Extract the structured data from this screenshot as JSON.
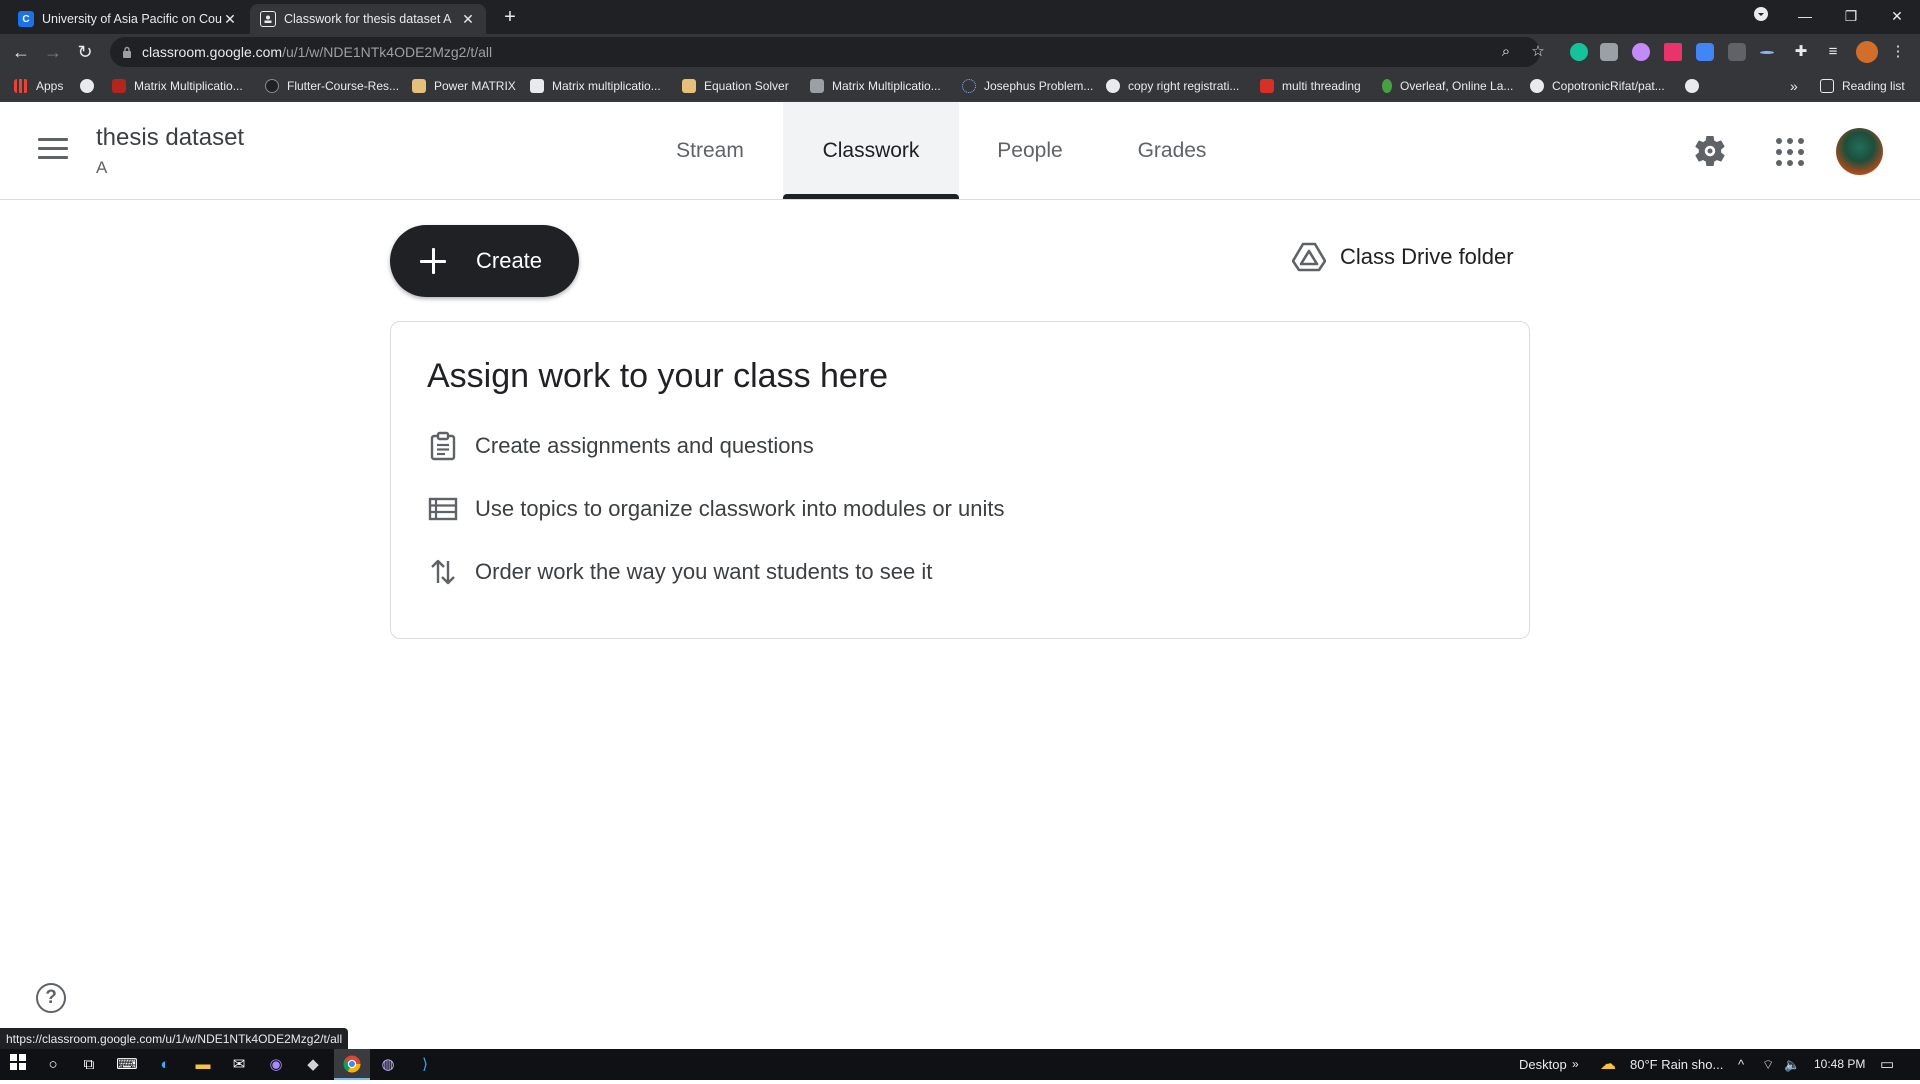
{
  "browser": {
    "tabs": [
      {
        "title": "University of Asia Pacific on Cour",
        "favicon": "C"
      },
      {
        "title": "Classwork for thesis dataset A"
      }
    ],
    "new_tab_label": "+",
    "url_host": "classroom.google.com",
    "url_path": "/u/1/w/NDE1NTk4ODE2Mzg2/t/all",
    "bookmarks": [
      "Apps",
      "Matrix Multiplicatio...",
      "Flutter-Course-Res...",
      "Power MATRIX",
      "Matrix multiplicatio...",
      "Equation Solver",
      "Matrix Multiplicatio...",
      "Josephus Problem...",
      "copy right registrati...",
      "multi threading",
      "Overleaf, Online La...",
      "CopotronicRifat/pat..."
    ],
    "bookmarks_overflow": "»",
    "reading_list": "Reading list",
    "status_url": "https://classroom.google.com/u/1/w/NDE1NTk4ODE2Mzg2/t/all"
  },
  "classroom": {
    "class_name": "thesis dataset",
    "section": "A",
    "tabs": [
      "Stream",
      "Classwork",
      "People",
      "Grades"
    ],
    "active_tab": "Classwork"
  },
  "classwork": {
    "create_label": "Create",
    "drive_label": "Class Drive folder",
    "card_title": "Assign work to your class here",
    "tips": [
      {
        "icon": "assignment-icon",
        "text": "Create assignments and questions"
      },
      {
        "icon": "topic-list-icon",
        "text": "Use topics to organize classwork into modules or units"
      },
      {
        "icon": "reorder-icon",
        "text": "Order work the way you want students to see it"
      }
    ],
    "help_label": "?"
  },
  "taskbar": {
    "desktop_label": "Desktop",
    "overflow": "»",
    "weather": "80°F  Rain sho...",
    "time": "10:48 PM"
  },
  "colors": {
    "chrome_dark": "#202124",
    "chrome_toolbar": "#35363a",
    "text_primary": "#202124",
    "text_secondary": "#5f6368",
    "border": "#dadce0"
  }
}
